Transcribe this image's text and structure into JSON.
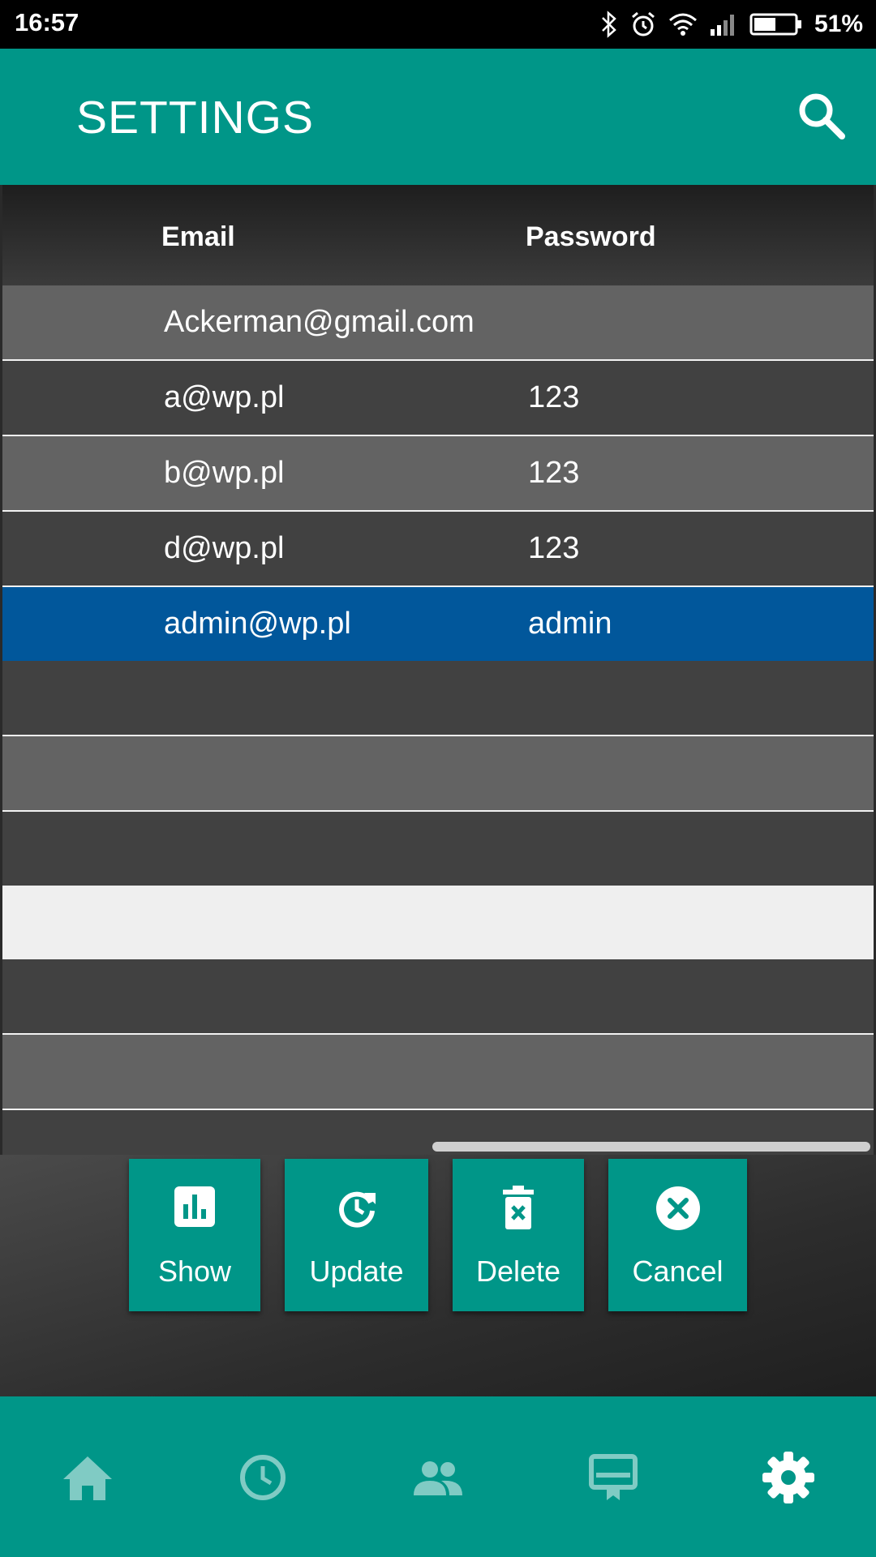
{
  "status": {
    "time": "16:57",
    "battery": "51%",
    "icons": [
      "bluetooth-icon",
      "alarm-icon",
      "wifi-icon",
      "signal-icon",
      "battery-icon"
    ]
  },
  "appbar": {
    "title": "SETTINGS",
    "search_icon": "search-icon"
  },
  "table": {
    "columns": {
      "email": "Email",
      "password": "Password"
    },
    "rows": [
      {
        "email": "Ackerman@gmail.com",
        "password": ""
      },
      {
        "email": "a@wp.pl",
        "password": "123"
      },
      {
        "email": "b@wp.pl",
        "password": "123"
      },
      {
        "email": "d@wp.pl",
        "password": "123"
      },
      {
        "email": "admin@wp.pl",
        "password": "admin",
        "selected": true
      }
    ]
  },
  "actions": {
    "show": "Show",
    "update": "Update",
    "delete": "Delete",
    "cancel": "Cancel"
  },
  "nav": {
    "items": [
      "home-icon",
      "history-icon",
      "people-icon",
      "card-icon",
      "settings-icon"
    ],
    "active": "settings-icon"
  },
  "colors": {
    "primary": "#009688",
    "selected_row": "#01579b",
    "inactive_nav_icon": "#80cbc4"
  }
}
